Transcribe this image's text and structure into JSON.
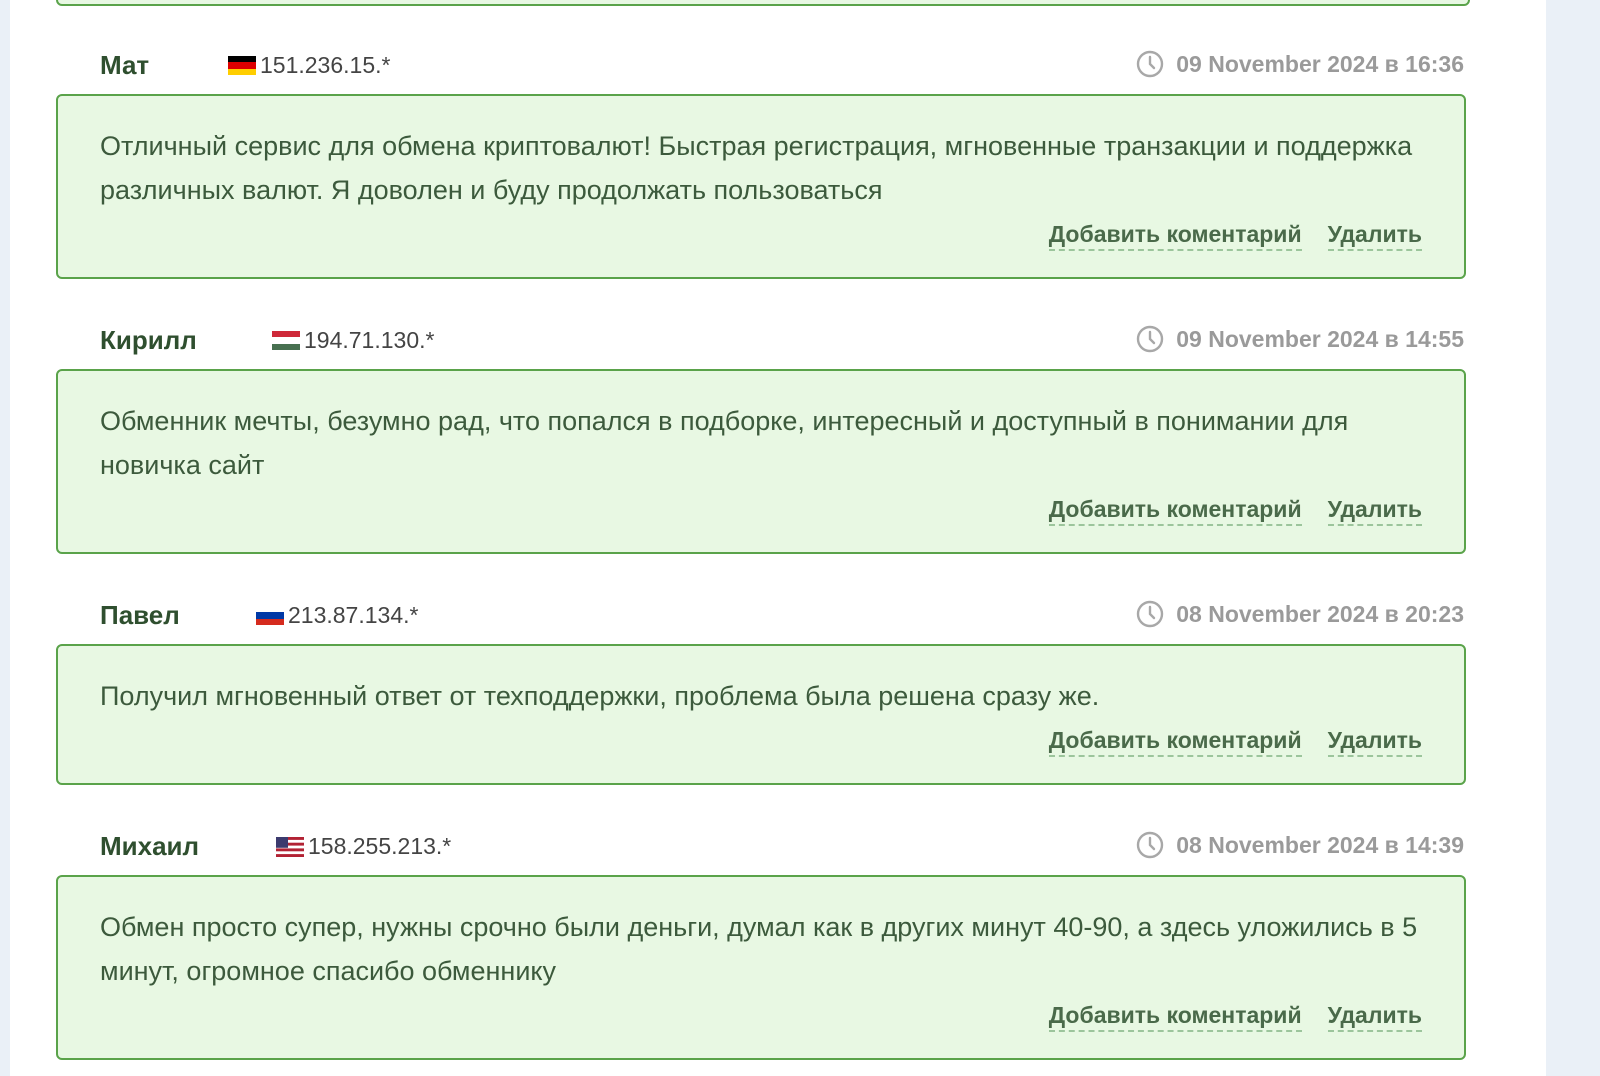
{
  "actions": {
    "add_comment": "Добавить коментарий",
    "delete": "Удалить"
  },
  "reviews": [
    {
      "author": "Мат",
      "flag": "de",
      "ip": "151.236.15.*",
      "date": "09 November 2024 в 16:36",
      "text": "Отличный сервис для обмена криптовалют! Быстрая регистрация, мгновенные транзакции и поддержка различных валют. Я доволен и буду продолжать пользоваться"
    },
    {
      "author": "Кирилл",
      "flag": "hu",
      "ip": "194.71.130.*",
      "date": "09 November 2024 в 14:55",
      "text": "Обменник мечты, безумно рад, что попался в подборке, интересный и доступный в понимании для новичка сайт"
    },
    {
      "author": "Павел",
      "flag": "ru",
      "ip": "213.87.134.*",
      "date": "08 November 2024 в 20:23",
      "text": "Получил мгновенный ответ от техподдержки, проблема была решена сразу же."
    },
    {
      "author": "Михаил",
      "flag": "us",
      "ip": "158.255.213.*",
      "date": "08 November 2024 в 14:39",
      "text": "Обмен просто супер, нужны срочно были деньги, думал как в других минут 40-90, а здесь уложились в 5 минут, огромное спасибо обменнику"
    }
  ],
  "colors": {
    "box_border": "#5aa34a",
    "box_background": "#e8f8e3",
    "author": "#2f4f2f",
    "date": "#9a9a9a"
  }
}
